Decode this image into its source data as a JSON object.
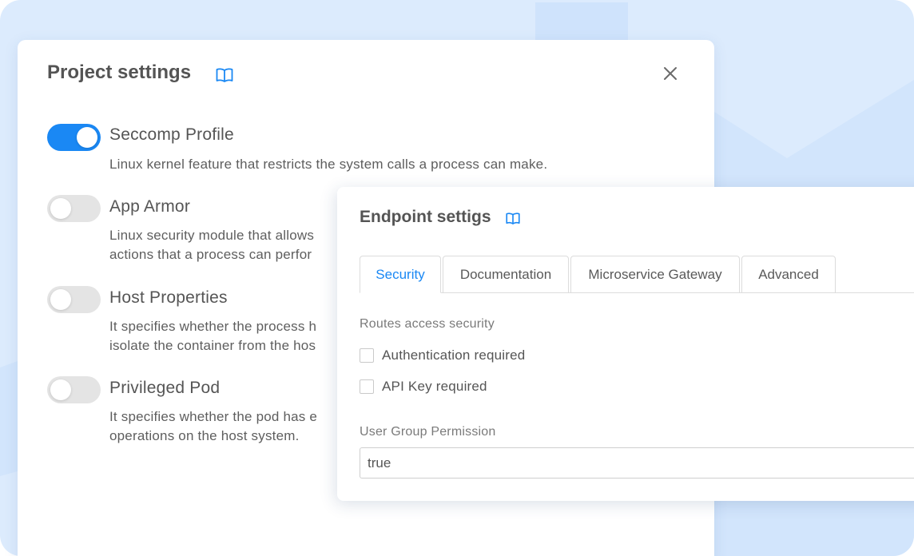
{
  "project_settings": {
    "title": "Project settings",
    "doc_icon": "book-open-icon",
    "close_icon": "close-icon",
    "options": [
      {
        "label": "Seccomp Profile",
        "enabled": true,
        "desc_line1": "Linux kernel feature that restricts the system calls a process can make.",
        "desc_line2": ""
      },
      {
        "label": "App Armor",
        "enabled": false,
        "desc_line1": "Linux security module that allows",
        "desc_line2": "actions that a process can perfor"
      },
      {
        "label": "Host Properties",
        "enabled": false,
        "desc_line1": "It specifies whether the process h",
        "desc_line2": "isolate the container from the hos"
      },
      {
        "label": "Privileged Pod",
        "enabled": false,
        "desc_line1": "It specifies whether the pod has e",
        "desc_line2": "operations on the host system."
      }
    ]
  },
  "endpoint_settings": {
    "title": "Endpoint settigs",
    "doc_icon": "book-open-icon",
    "tabs": [
      {
        "label": "Security",
        "active": true
      },
      {
        "label": "Documentation",
        "active": false
      },
      {
        "label": "Microservice Gateway",
        "active": false
      },
      {
        "label": "Advanced",
        "active": false
      }
    ],
    "routes_section_label": "Routes access security",
    "checkboxes": [
      {
        "label": "Authentication required",
        "checked": false
      },
      {
        "label": "API Key required",
        "checked": false
      }
    ],
    "permission_label": "User Group Permission",
    "permission_value": "true"
  },
  "colors": {
    "accent": "#1a88f4",
    "backdrop": "#dcebfd",
    "toggle_off": "#e4e4e4"
  }
}
